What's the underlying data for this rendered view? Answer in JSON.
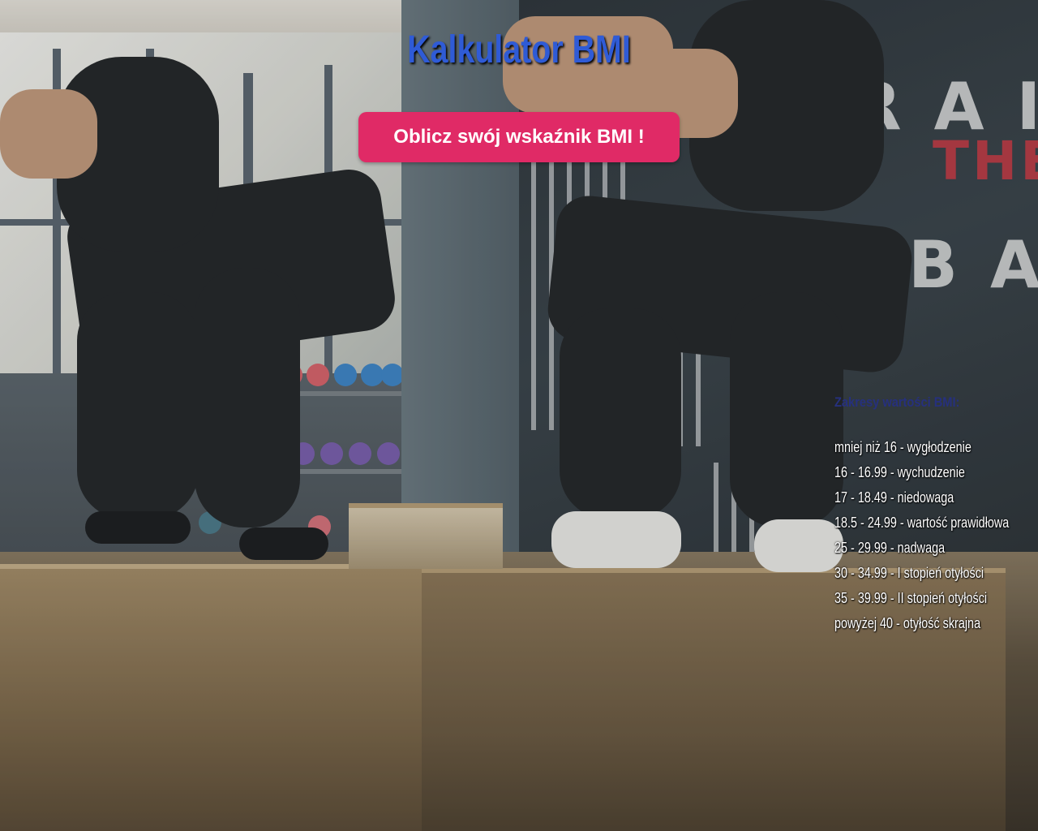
{
  "header": {
    "title": "Kalkulator BMI"
  },
  "cta": {
    "label": "Oblicz swój wskaźnik BMI !",
    "color": "#e02a66"
  },
  "ranges": {
    "heading": "Zakresy wartości BMI:",
    "items": [
      "mniej niż 16 - wygłodzenie",
      "16 - 16.99 - wychudzenie",
      "17 - 18.49 - niedowaga",
      "18.5 - 24.99 - wartość prawidłowa",
      "25 - 29.99 - nadwaga",
      "30 - 34.99 - I stopień otyłości",
      "35 - 39.99 - II stopień otyłości",
      "powyżej 40 - otyłość skrajna"
    ]
  },
  "background": {
    "subject": "gym-box-jump-photo",
    "wall_text": [
      "RAI",
      "THE",
      "BA"
    ]
  }
}
